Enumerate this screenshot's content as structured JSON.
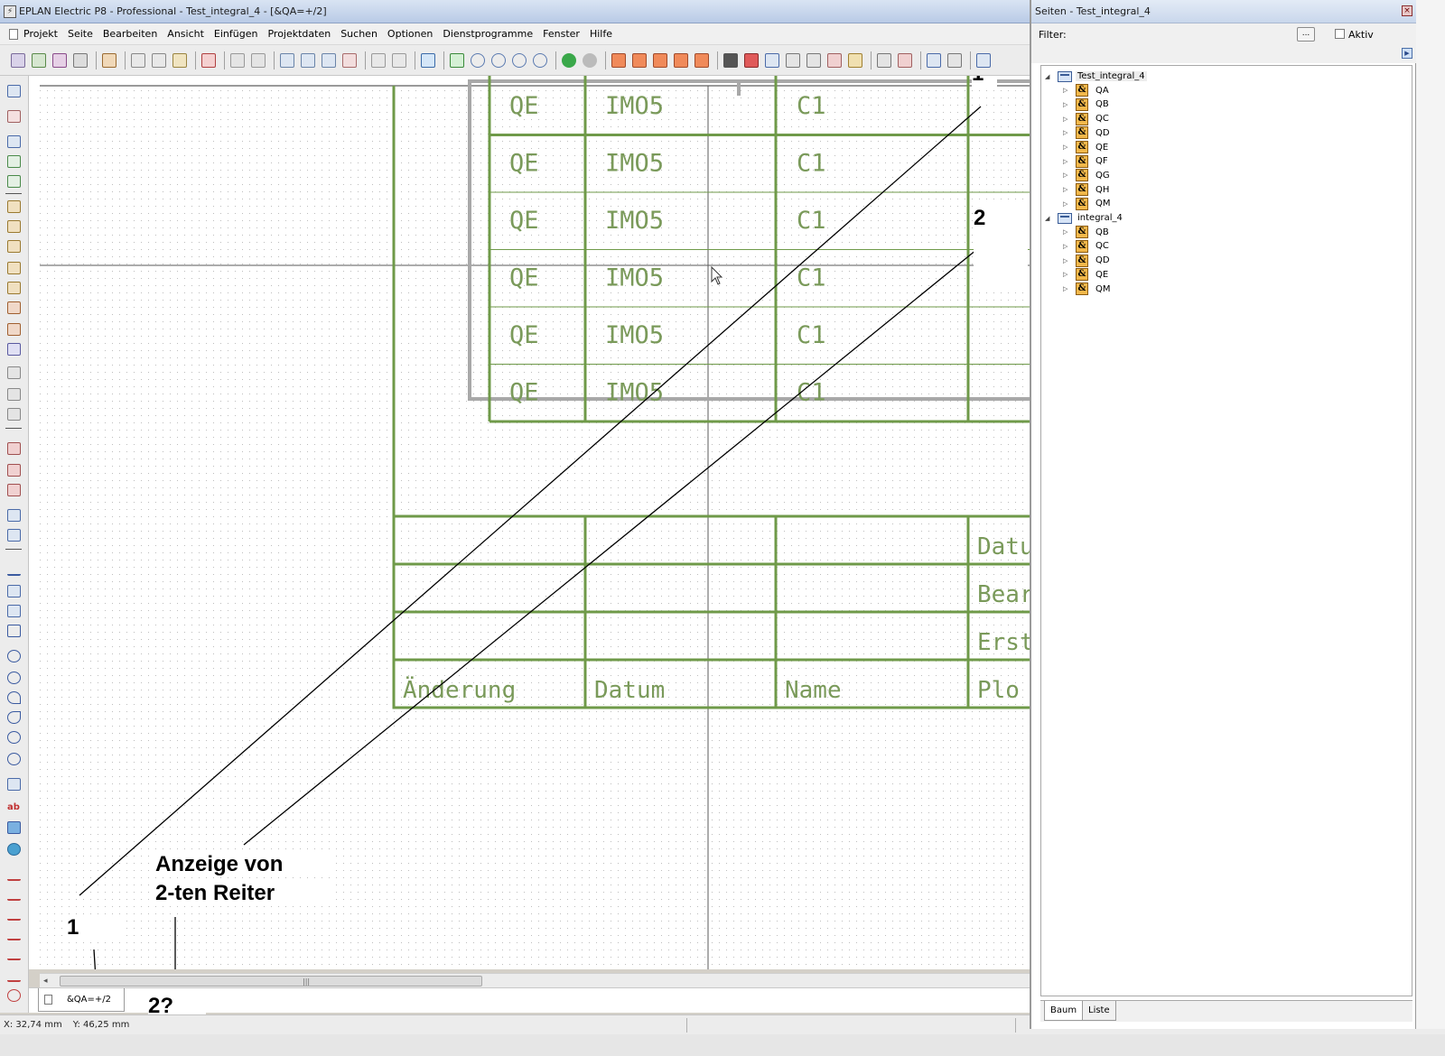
{
  "window": {
    "title": "EPLAN Electric P8 - Professional - Test_integral_4 - [&QA=+/2]"
  },
  "menu": {
    "items": [
      "Projekt",
      "Seite",
      "Bearbeiten",
      "Ansicht",
      "Einfügen",
      "Projektdaten",
      "Suchen",
      "Optionen",
      "Dienstprogramme",
      "Fenster",
      "Hilfe"
    ]
  },
  "drawing": {
    "table_rows": [
      {
        "c1": "QE",
        "c2": "IMO5",
        "c3": "C1"
      },
      {
        "c1": "QE",
        "c2": "IMO5",
        "c3": "C1"
      },
      {
        "c1": "QE",
        "c2": "IMO5",
        "c3": "C1"
      },
      {
        "c1": "QE",
        "c2": "IMO5",
        "c3": "C1"
      },
      {
        "c1": "QE",
        "c2": "IMO5",
        "c3": "C1"
      },
      {
        "c1": "QE",
        "c2": "IMO5",
        "c3": "C1"
      }
    ],
    "titleblock": {
      "right_labels": [
        "Datu",
        "Bear",
        "Erst",
        "Plo"
      ],
      "bottom_labels": [
        "Änderung",
        "Datum",
        "Name"
      ]
    },
    "colors": {
      "frame": "#6f9a49",
      "text": "#7a9a5a",
      "grid": "#c8c8c8"
    }
  },
  "annotations": {
    "label_1_top": "1",
    "label_2_top": "2",
    "label_1_bottom": "1",
    "caption_line1": "Anzeige von",
    "caption_line2": "2-ten Reiter",
    "label_2_question": "2?"
  },
  "page_tabs": [
    {
      "label": "&QA=+/2",
      "active": true
    }
  ],
  "status": {
    "x": "X: 32,74 mm",
    "y": "Y: 46,25 mm"
  },
  "pages_panel": {
    "title": "Seiten - Test_integral_4",
    "filter_label": "Filter:",
    "filter_button": "...",
    "aktiv_label": "Aktiv",
    "tree": [
      {
        "label": "Test_integral_4",
        "type": "project",
        "level": 0,
        "selected": true,
        "children": [
          "QA",
          "QB",
          "QC",
          "QD",
          "QE",
          "QF",
          "QG",
          "QH",
          "QM"
        ]
      },
      {
        "label": "integral_4",
        "type": "project",
        "level": 0,
        "selected": false,
        "children": [
          "QB",
          "QC",
          "QD",
          "QE",
          "QM"
        ]
      }
    ],
    "tabs": [
      "Baum",
      "Liste"
    ]
  }
}
